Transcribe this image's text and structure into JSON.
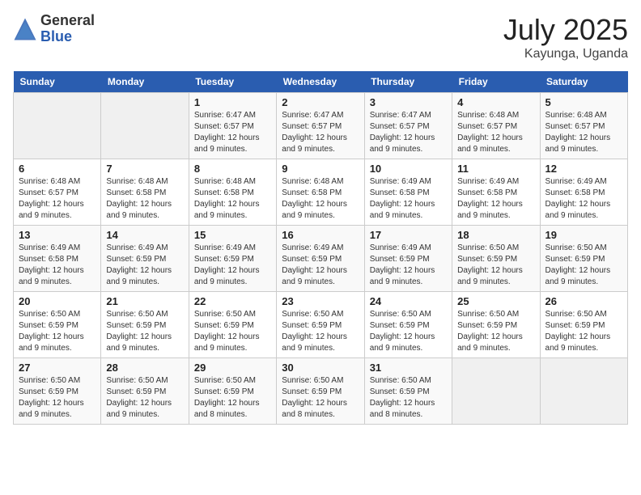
{
  "header": {
    "logo_general": "General",
    "logo_blue": "Blue",
    "month_year": "July 2025",
    "location": "Kayunga, Uganda"
  },
  "days_of_week": [
    "Sunday",
    "Monday",
    "Tuesday",
    "Wednesday",
    "Thursday",
    "Friday",
    "Saturday"
  ],
  "weeks": [
    [
      {
        "day": "",
        "info": ""
      },
      {
        "day": "",
        "info": ""
      },
      {
        "day": "1",
        "info": "Sunrise: 6:47 AM\nSunset: 6:57 PM\nDaylight: 12 hours\nand 9 minutes."
      },
      {
        "day": "2",
        "info": "Sunrise: 6:47 AM\nSunset: 6:57 PM\nDaylight: 12 hours\nand 9 minutes."
      },
      {
        "day": "3",
        "info": "Sunrise: 6:47 AM\nSunset: 6:57 PM\nDaylight: 12 hours\nand 9 minutes."
      },
      {
        "day": "4",
        "info": "Sunrise: 6:48 AM\nSunset: 6:57 PM\nDaylight: 12 hours\nand 9 minutes."
      },
      {
        "day": "5",
        "info": "Sunrise: 6:48 AM\nSunset: 6:57 PM\nDaylight: 12 hours\nand 9 minutes."
      }
    ],
    [
      {
        "day": "6",
        "info": "Sunrise: 6:48 AM\nSunset: 6:57 PM\nDaylight: 12 hours\nand 9 minutes."
      },
      {
        "day": "7",
        "info": "Sunrise: 6:48 AM\nSunset: 6:58 PM\nDaylight: 12 hours\nand 9 minutes."
      },
      {
        "day": "8",
        "info": "Sunrise: 6:48 AM\nSunset: 6:58 PM\nDaylight: 12 hours\nand 9 minutes."
      },
      {
        "day": "9",
        "info": "Sunrise: 6:48 AM\nSunset: 6:58 PM\nDaylight: 12 hours\nand 9 minutes."
      },
      {
        "day": "10",
        "info": "Sunrise: 6:49 AM\nSunset: 6:58 PM\nDaylight: 12 hours\nand 9 minutes."
      },
      {
        "day": "11",
        "info": "Sunrise: 6:49 AM\nSunset: 6:58 PM\nDaylight: 12 hours\nand 9 minutes."
      },
      {
        "day": "12",
        "info": "Sunrise: 6:49 AM\nSunset: 6:58 PM\nDaylight: 12 hours\nand 9 minutes."
      }
    ],
    [
      {
        "day": "13",
        "info": "Sunrise: 6:49 AM\nSunset: 6:58 PM\nDaylight: 12 hours\nand 9 minutes."
      },
      {
        "day": "14",
        "info": "Sunrise: 6:49 AM\nSunset: 6:59 PM\nDaylight: 12 hours\nand 9 minutes."
      },
      {
        "day": "15",
        "info": "Sunrise: 6:49 AM\nSunset: 6:59 PM\nDaylight: 12 hours\nand 9 minutes."
      },
      {
        "day": "16",
        "info": "Sunrise: 6:49 AM\nSunset: 6:59 PM\nDaylight: 12 hours\nand 9 minutes."
      },
      {
        "day": "17",
        "info": "Sunrise: 6:49 AM\nSunset: 6:59 PM\nDaylight: 12 hours\nand 9 minutes."
      },
      {
        "day": "18",
        "info": "Sunrise: 6:50 AM\nSunset: 6:59 PM\nDaylight: 12 hours\nand 9 minutes."
      },
      {
        "day": "19",
        "info": "Sunrise: 6:50 AM\nSunset: 6:59 PM\nDaylight: 12 hours\nand 9 minutes."
      }
    ],
    [
      {
        "day": "20",
        "info": "Sunrise: 6:50 AM\nSunset: 6:59 PM\nDaylight: 12 hours\nand 9 minutes."
      },
      {
        "day": "21",
        "info": "Sunrise: 6:50 AM\nSunset: 6:59 PM\nDaylight: 12 hours\nand 9 minutes."
      },
      {
        "day": "22",
        "info": "Sunrise: 6:50 AM\nSunset: 6:59 PM\nDaylight: 12 hours\nand 9 minutes."
      },
      {
        "day": "23",
        "info": "Sunrise: 6:50 AM\nSunset: 6:59 PM\nDaylight: 12 hours\nand 9 minutes."
      },
      {
        "day": "24",
        "info": "Sunrise: 6:50 AM\nSunset: 6:59 PM\nDaylight: 12 hours\nand 9 minutes."
      },
      {
        "day": "25",
        "info": "Sunrise: 6:50 AM\nSunset: 6:59 PM\nDaylight: 12 hours\nand 9 minutes."
      },
      {
        "day": "26",
        "info": "Sunrise: 6:50 AM\nSunset: 6:59 PM\nDaylight: 12 hours\nand 9 minutes."
      }
    ],
    [
      {
        "day": "27",
        "info": "Sunrise: 6:50 AM\nSunset: 6:59 PM\nDaylight: 12 hours\nand 9 minutes."
      },
      {
        "day": "28",
        "info": "Sunrise: 6:50 AM\nSunset: 6:59 PM\nDaylight: 12 hours\nand 9 minutes."
      },
      {
        "day": "29",
        "info": "Sunrise: 6:50 AM\nSunset: 6:59 PM\nDaylight: 12 hours\nand 8 minutes."
      },
      {
        "day": "30",
        "info": "Sunrise: 6:50 AM\nSunset: 6:59 PM\nDaylight: 12 hours\nand 8 minutes."
      },
      {
        "day": "31",
        "info": "Sunrise: 6:50 AM\nSunset: 6:59 PM\nDaylight: 12 hours\nand 8 minutes."
      },
      {
        "day": "",
        "info": ""
      },
      {
        "day": "",
        "info": ""
      }
    ]
  ]
}
